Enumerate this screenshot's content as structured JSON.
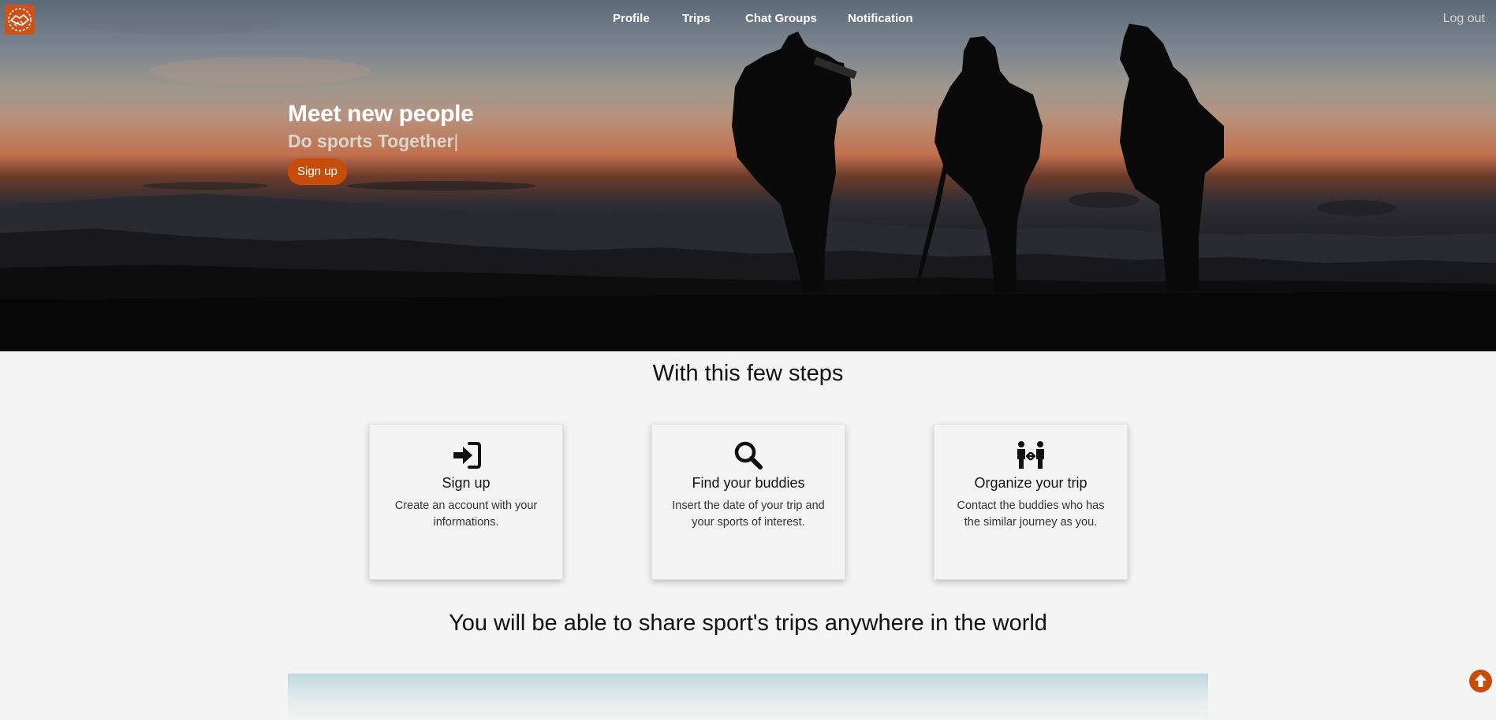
{
  "nav": {
    "items": [
      {
        "label": "Profile"
      },
      {
        "label": "Trips"
      },
      {
        "label": "Chat Groups"
      },
      {
        "label": "Notification"
      }
    ],
    "logout_label": "Log out"
  },
  "hero": {
    "headline": "Meet new people",
    "subline": "Do sports Together",
    "caret": "|",
    "button_label": "Sign up"
  },
  "steps": {
    "title": "With this few steps",
    "cards": [
      {
        "icon": "sign-in-icon",
        "title": "Sign up",
        "text": "Create an account with your informations."
      },
      {
        "icon": "search-icon",
        "title": "Find your buddies",
        "text": "Insert the date of your trip and your sports of interest."
      },
      {
        "icon": "people-exchange-icon",
        "title": "Organize your trip",
        "text": "Contact the buddies who has the similar journey as you."
      }
    ]
  },
  "world": {
    "title": "You will be able to share sport's trips anywhere in the world"
  },
  "colors": {
    "accent": "#c64d0c",
    "background": "#f4f4f4",
    "text": "#111111"
  }
}
